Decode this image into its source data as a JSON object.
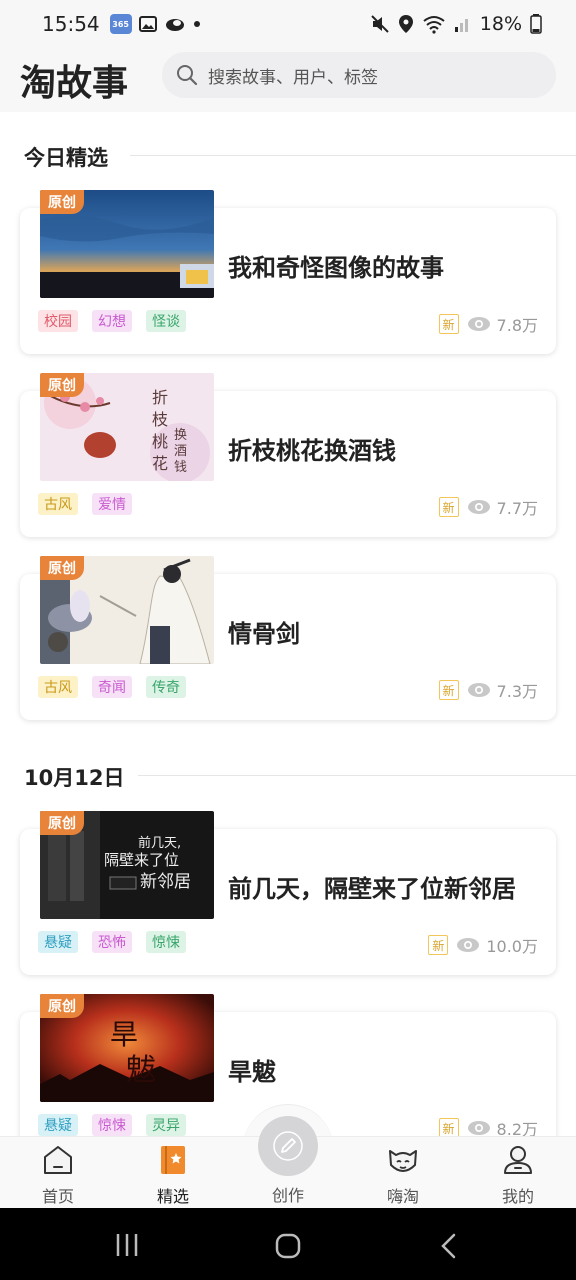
{
  "status_bar": {
    "time": "15:54",
    "battery": "18%",
    "icons": [
      "app-365-icon",
      "gallery-icon",
      "cloud-icon",
      "dot-icon",
      "mute-icon",
      "location-icon",
      "wifi-icon",
      "signal-icon",
      "battery-icon"
    ]
  },
  "header": {
    "logo": "淘故事",
    "search_placeholder": "搜索故事、用户、标签"
  },
  "sections": [
    {
      "title": "今日精选",
      "stories": [
        {
          "badge": "原创",
          "title": "我和奇怪图像的故事",
          "tags": [
            {
              "label": "校园",
              "bg": "#fde3e6",
              "color": "#e05a6a"
            },
            {
              "label": "幻想",
              "bg": "#f7e1f7",
              "color": "#c95bd0"
            },
            {
              "label": "怪谈",
              "bg": "#dcf3e6",
              "color": "#3aa56b"
            }
          ],
          "new_label": "新",
          "views": "7.8万"
        },
        {
          "badge": "原创",
          "title": "折枝桃花换酒钱",
          "tags": [
            {
              "label": "古风",
              "bg": "#fdf1c7",
              "color": "#c99a1a"
            },
            {
              "label": "爱情",
              "bg": "#f7e1f7",
              "color": "#c95bd0"
            }
          ],
          "new_label": "新",
          "views": "7.7万"
        },
        {
          "badge": "原创",
          "title": "情骨剑",
          "tags": [
            {
              "label": "古风",
              "bg": "#fdf1c7",
              "color": "#c99a1a"
            },
            {
              "label": "奇闻",
              "bg": "#f7e1f7",
              "color": "#c95bd0"
            },
            {
              "label": "传奇",
              "bg": "#dcf3e6",
              "color": "#3aa56b"
            }
          ],
          "new_label": "新",
          "views": "7.3万"
        }
      ]
    },
    {
      "title": "10月12日",
      "stories": [
        {
          "badge": "原创",
          "title": "前几天，隔壁来了位新邻居",
          "tags": [
            {
              "label": "悬疑",
              "bg": "#d7f1f7",
              "color": "#2f9fc0"
            },
            {
              "label": "恐怖",
              "bg": "#f7e1f7",
              "color": "#c95bd0"
            },
            {
              "label": "惊悚",
              "bg": "#dcf3e6",
              "color": "#3aa56b"
            }
          ],
          "new_label": "新",
          "views": "10.0万"
        },
        {
          "badge": "原创",
          "title": "旱魃",
          "tags": [
            {
              "label": "悬疑",
              "bg": "#d7f1f7",
              "color": "#2f9fc0"
            },
            {
              "label": "惊悚",
              "bg": "#f7e1f7",
              "color": "#c95bd0"
            },
            {
              "label": "灵异",
              "bg": "#dcf3e6",
              "color": "#3aa56b"
            }
          ],
          "new_label": "新",
          "views": "8.2万"
        }
      ]
    }
  ],
  "bottom_nav": {
    "home": "首页",
    "featured": "精选",
    "create": "创作",
    "hai_tao": "嗨淘",
    "mine": "我的"
  },
  "colors": {
    "brand_orange": "#f5a524",
    "badge_orange": "#e8843a",
    "active_nav": "#f08a2c"
  }
}
